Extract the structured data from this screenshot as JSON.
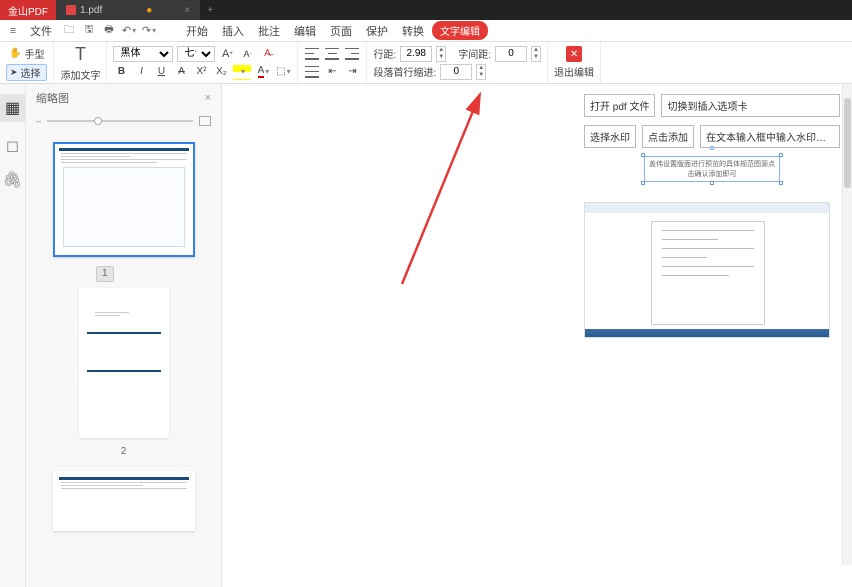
{
  "titlebar": {
    "brand": "金山PDF",
    "tab_label": "1.pdf",
    "unsaved_mark": "●",
    "tab_close": "×",
    "newtab": "+"
  },
  "menu": {
    "file_label": "文件",
    "items": [
      "开始",
      "插入",
      "批注",
      "编辑",
      "页面",
      "保护",
      "转换"
    ],
    "active_pill": "文字编辑"
  },
  "ribbon": {
    "hand": "手型",
    "select": "选择",
    "addtext": "添加文字",
    "font_family": "黑体",
    "font_size": "七号",
    "bold": "B",
    "italic": "I",
    "underline": "U",
    "line_spacing_label": "行距:",
    "line_spacing_value": "2.98",
    "char_spacing_label": "字间距:",
    "char_spacing_value": "0",
    "first_indent_label": "段落首行缩进:",
    "first_indent_value": "0",
    "exit_edit": "退出编辑"
  },
  "thumbnails": {
    "title": "缩略图",
    "close": "×",
    "pages": [
      "1",
      "2"
    ]
  },
  "preview": {
    "row1": [
      "打开 pdf 文件",
      "切换到插入选项卡"
    ],
    "row2": [
      "选择水印",
      "点击添加",
      "在文本输入框中输入水印内容。。。。。"
    ],
    "ghost_text": "盖伟设置版面进行预览的具体规范图源点击确认添加即可"
  },
  "icons": {
    "row_icon": "▦",
    "bookmark": "◻",
    "attach": "🖇"
  }
}
